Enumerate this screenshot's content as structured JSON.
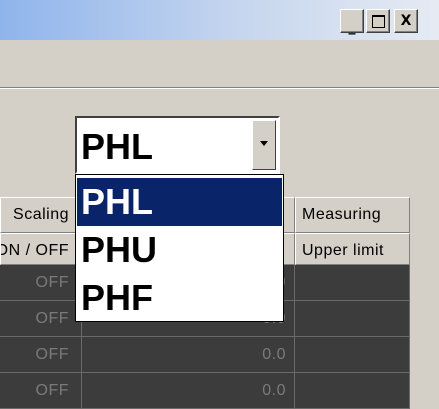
{
  "window": {
    "minimize_label": "_",
    "close_label": "X"
  },
  "combo": {
    "value": "PHL",
    "options": [
      "PHL",
      "PHU",
      "PHF"
    ],
    "selected_index": 0
  },
  "grid": {
    "headers": {
      "col1_top": "Scaling",
      "col1_sub": "ON / OFF",
      "col3_top": "Measuring",
      "col3_sub": "Upper limit"
    },
    "partial_row_value": "0",
    "rows": [
      {
        "onoff": "OFF",
        "value": "0.0"
      },
      {
        "onoff": "OFF",
        "value": "0.0"
      },
      {
        "onoff": "OFF",
        "value": "0.0"
      },
      {
        "onoff": "OFF",
        "value": "0.0"
      }
    ]
  }
}
